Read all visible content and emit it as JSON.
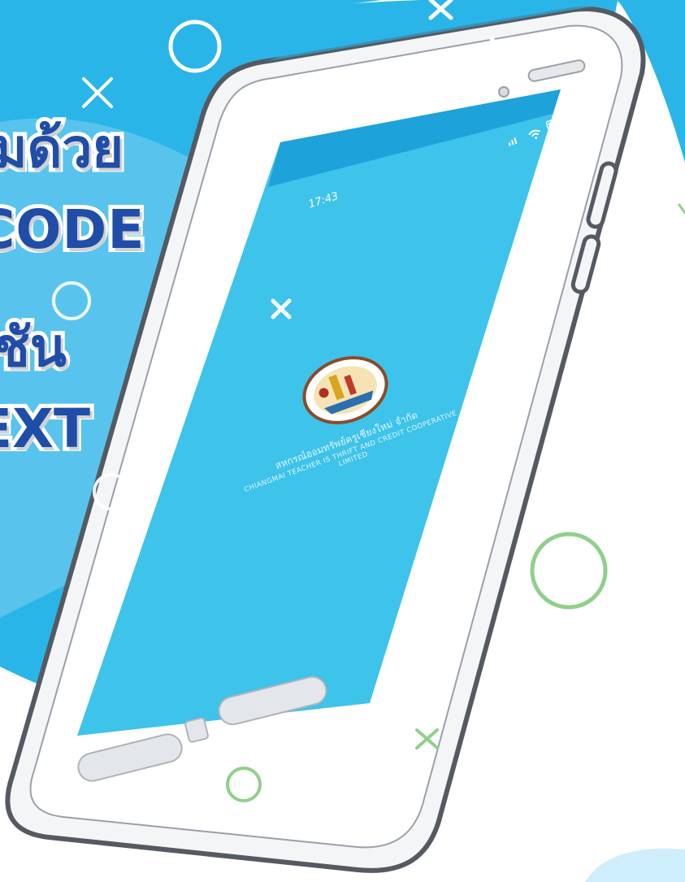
{
  "headline": {
    "line1": "มด้วย",
    "line2": "CODE",
    "line3": "ชัน",
    "line4": "EXT"
  },
  "phone": {
    "status_time": "17:43",
    "org_name_th": "สหกรณ์ออมทรัพย์ครูเชียงใหม่ จำกัด",
    "org_name_en_1": "CHIANGMAI TEACHER IS THRIFT AND CREDIT COOPERATIVE",
    "org_name_en_2": "LIMITED"
  },
  "colors": {
    "sky_blue": "#29b5e8",
    "screen_blue": "#3ec3ea",
    "headline_navy": "#1f4da8",
    "deco_green": "#8fd08a",
    "phone_body": "#f2f3f5",
    "phone_outline": "#555a62"
  },
  "icons": [
    "wifi-icon",
    "battery-icon",
    "signal-icon",
    "cross-decoration-icon",
    "circle-decoration-icon"
  ]
}
